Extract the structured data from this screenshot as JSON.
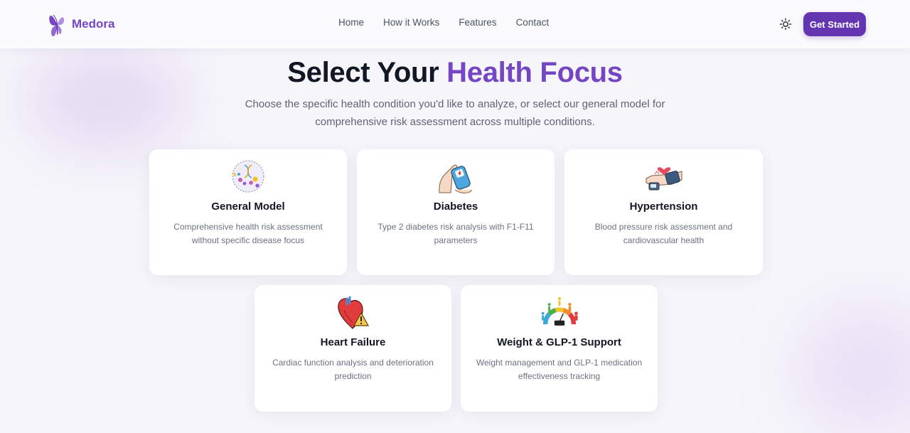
{
  "nav": {
    "brand": "Medora",
    "links": [
      "Home",
      "How it Works",
      "Features",
      "Contact"
    ],
    "cta_label": "Get Started",
    "theme_icon": "sun-icon",
    "logo_icon": "butterfly-icon"
  },
  "hero": {
    "title_lead": "Select Your ",
    "title_accent": "Health Focus",
    "subtitle": "Choose the specific health condition you'd like to analyze, or select our general model for comprehensive risk assessment across multiple conditions."
  },
  "cards": [
    {
      "title": "General Model",
      "description": "Comprehensive health risk assessment without specific disease focus",
      "icon": "dna-molecules-icon"
    },
    {
      "title": "Diabetes",
      "description": "Type 2 diabetes risk analysis with F1-F11 parameters",
      "icon": "glucose-meter-icon"
    },
    {
      "title": "Hypertension",
      "description": "Blood pressure risk assessment and cardiovascular health",
      "icon": "blood-pressure-cuff-icon"
    },
    {
      "title": "Heart Failure",
      "description": "Cardiac function analysis and deterioration prediction",
      "icon": "heart-warning-icon"
    },
    {
      "title": "Weight & GLP-1 Support",
      "description": "Weight management and GLP-1 medication effectiveness tracking",
      "icon": "bmi-gauge-icon"
    }
  ],
  "colors": {
    "brand": "#7446c4",
    "cta": "#6435b0",
    "background": "#f6f5fa",
    "heading": "#121726"
  }
}
